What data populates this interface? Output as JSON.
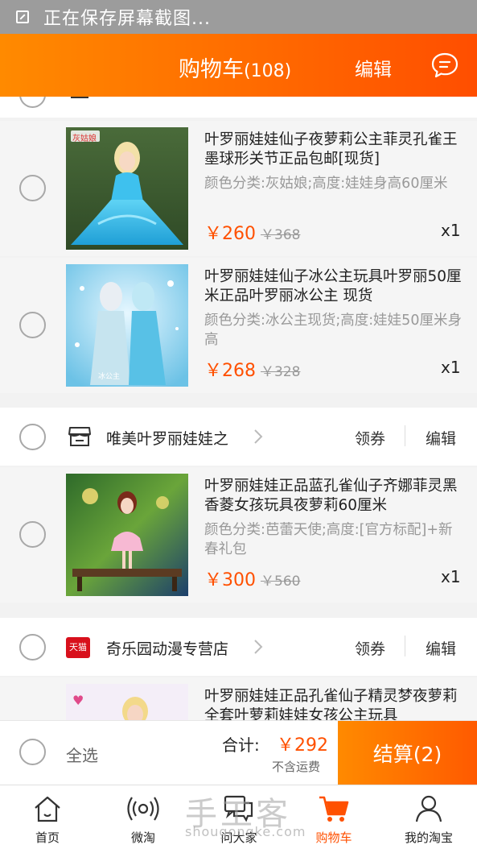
{
  "status_bar": {
    "text": "正在保存屏幕截图..."
  },
  "header": {
    "title": "购物车",
    "count": "(108)",
    "edit": "编辑"
  },
  "items": [
    {
      "name": "叶罗丽娃娃仙子夜萝莉公主菲灵孔雀王墨球形关节正品包邮[现货]",
      "spec": "颜色分类:灰姑娘;高度:娃娃身高60厘米",
      "price": "￥260",
      "old_price": "￥368",
      "qty": "x1",
      "thumb_label": "灰姑娘"
    },
    {
      "name": "叶罗丽娃娃仙子冰公主玩具叶罗丽50厘米正品叶罗丽冰公主 现货",
      "spec": "颜色分类:冰公主现货;高度:娃娃50厘米身高",
      "price": "￥268",
      "old_price": "￥328",
      "qty": "x1",
      "thumb_label": "冰公主"
    },
    {
      "name": "叶罗丽娃娃正品蓝孔雀仙子齐娜菲灵黑香菱女孩玩具夜萝莉60厘米",
      "spec": "颜色分类:芭蕾天使;高度:[官方标配]+新春礼包",
      "price": "￥300",
      "old_price": "￥560",
      "qty": "x1"
    },
    {
      "name": "叶罗丽娃娃正品孔雀仙子精灵梦夜萝莉全套叶萝莉娃娃女孩公主玩具"
    }
  ],
  "shops": [
    {
      "name": "唯美叶罗丽娃娃之",
      "coupon": "领券",
      "edit": "编辑"
    },
    {
      "name": "奇乐园动漫专营店",
      "badge": "天猫",
      "coupon": "领券",
      "edit": "编辑"
    }
  ],
  "checkout": {
    "select_all": "全选",
    "total_label": "合计:",
    "total": "￥292",
    "shipping_note": "不含运费",
    "pay_button": "结算(2)"
  },
  "tabs": [
    {
      "label": "首页",
      "icon": "home-icon"
    },
    {
      "label": "微淘",
      "icon": "broadcast-icon"
    },
    {
      "label": "问大家",
      "icon": "chat-bubbles-icon"
    },
    {
      "label": "购物车",
      "icon": "cart-icon",
      "active": true
    },
    {
      "label": "我的淘宝",
      "icon": "person-icon"
    }
  ],
  "watermark": {
    "main": "手工客",
    "sub": "shougongke.com"
  },
  "colors": {
    "accent": "#ff5000",
    "header_start": "#ff8a00",
    "header_end": "#ff4e00"
  }
}
